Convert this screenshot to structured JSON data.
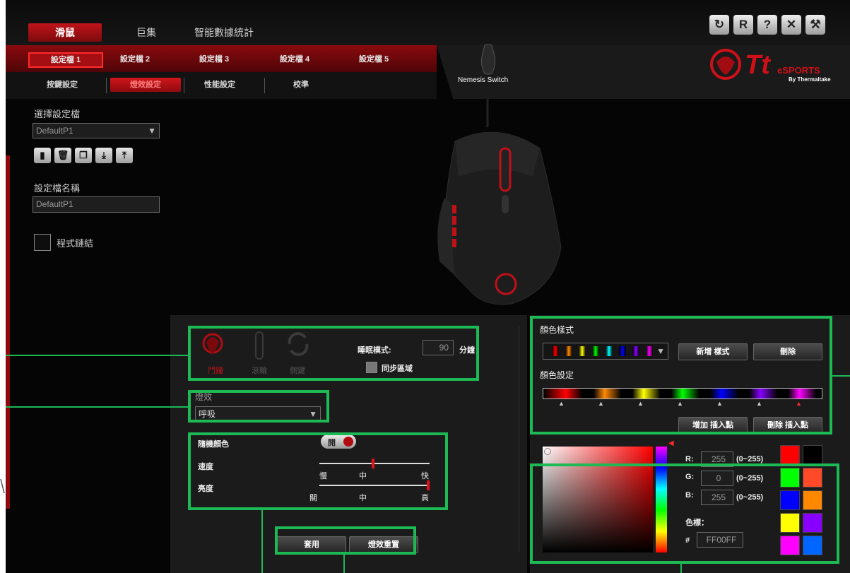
{
  "window": {
    "buttons": [
      {
        "name": "refresh-icon",
        "glyph": "↻"
      },
      {
        "name": "reset-icon",
        "glyph": "R"
      },
      {
        "name": "help-icon",
        "glyph": "?"
      },
      {
        "name": "close-icon",
        "glyph": "✕"
      },
      {
        "name": "tools-icon",
        "glyph": "⚒"
      }
    ]
  },
  "main_tabs": [
    "滑鼠",
    "巨集",
    "智能數據統計"
  ],
  "profile_tabs": [
    "設定檔 1",
    "設定檔 2",
    "設定檔 3",
    "設定檔 4",
    "設定檔 5"
  ],
  "sub_tabs": [
    "按鍵設定",
    "燈效設定",
    "性能設定",
    "校準"
  ],
  "brand": {
    "device_name": "Nemesis Switch",
    "logo_main": "Tt",
    "logo_sub1": "eSPORTS",
    "logo_sub2": "By Thermaltake"
  },
  "left": {
    "select_profile_label": "選擇設定檔",
    "profile_select_value": "DefaultP1",
    "profile_name_label": "設定檔名稱",
    "profile_name_value": "DefaultP1",
    "program_link_label": "程式鏈結"
  },
  "lighting": {
    "modes": [
      "鬥鐘",
      "滾輪",
      "側鍵"
    ],
    "sleep_label": "睡眠模式:",
    "sleep_value": "90",
    "sleep_unit": "分鐘",
    "sync_label": "同步區域",
    "effect_label": "燈效",
    "effect_value": "呼吸",
    "random_color_label": "隨機顏色",
    "random_color_toggle": "開",
    "speed_label": "速度",
    "speed_ticks": [
      "慢",
      "中",
      "快"
    ],
    "speed_value": 0.5,
    "brightness_label": "亮度",
    "brightness_ticks": [
      "關",
      "中",
      "高"
    ],
    "brightness_value": 1.0,
    "apply_button": "套用",
    "reset_button": "燈效重置"
  },
  "color": {
    "style_label": "顏色樣式",
    "add_style_button": "新增 樣式",
    "delete_button": "刪除",
    "settings_label": "顏色設定",
    "add_point_button": "增加 插入點",
    "delete_point_button": "刪除 插入點",
    "r_label": "R:",
    "r_value": "255",
    "g_label": "G:",
    "g_value": "0",
    "b_label": "B:",
    "b_value": "255",
    "range": "(0~255)",
    "hex_label": "色標：",
    "hash": "#",
    "hex_value": "FF00FF",
    "swatches": [
      "#ff0000",
      "#000000",
      "#00ff00",
      "#ff4a2a",
      "#0000ff",
      "#ff8800",
      "#ffff00",
      "#8800ff",
      "#ff00ff",
      "#0066ff"
    ],
    "style_colors": [
      "#ff0000",
      "#ff8800",
      "#ffff00",
      "#00ff00",
      "#00ffff",
      "#0000ff",
      "#8800ff",
      "#ff00ff"
    ]
  }
}
